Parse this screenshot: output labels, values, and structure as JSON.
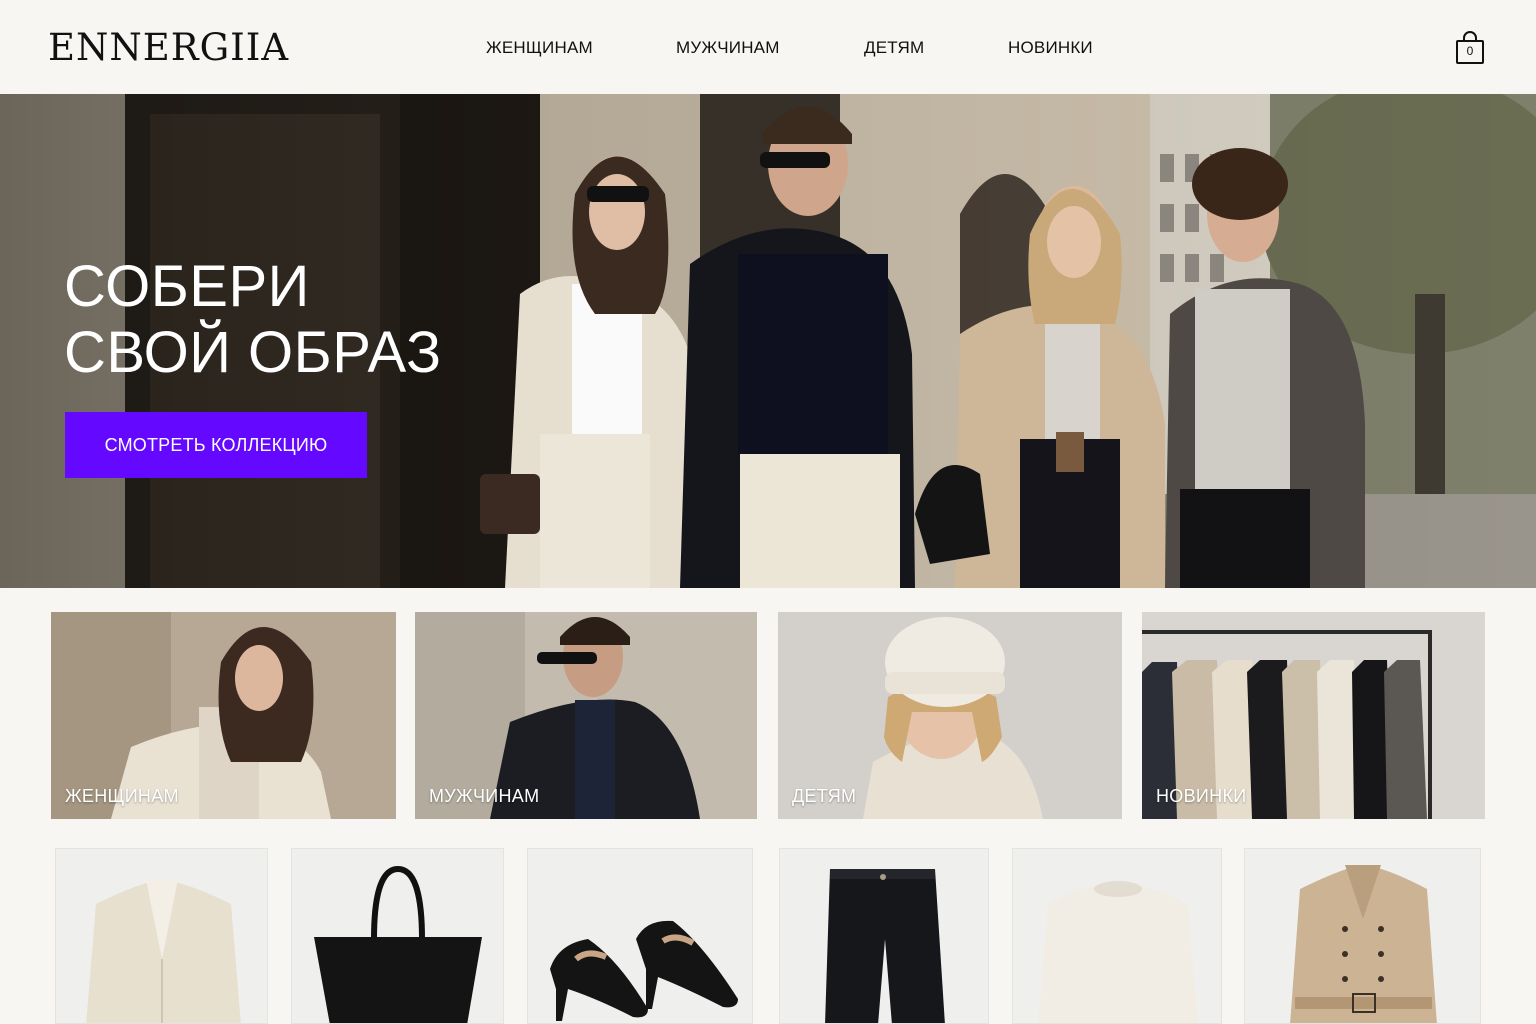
{
  "header": {
    "logo": "ENNERGIIA",
    "nav": [
      "ЖЕНЩИНАМ",
      "МУЖЧИНАМ",
      "ДЕТЯМ",
      "НОВИНКИ"
    ],
    "cart_count": "0",
    "cart_icon": "shopping-bag-icon"
  },
  "hero": {
    "title_line1": "СОБЕРИ",
    "title_line2": "СВОЙ ОБРАЗ",
    "cta": "СМОТРЕТЬ КОЛЛЕКЦИЮ",
    "cta_color": "#6508ff",
    "image": "four models in coats on a city street"
  },
  "categories": [
    {
      "label": "ЖЕНЩИНАМ",
      "image": "woman in cream coat"
    },
    {
      "label": "МУЖЧИНАМ",
      "image": "man in black jacket and sunglasses"
    },
    {
      "label": "ДЕТЯМ",
      "image": "child in beanie and quilted jacket"
    },
    {
      "label": "НОВИНКИ",
      "image": "coats on clothing rack"
    }
  ],
  "products": [
    {
      "image": "cream blazer"
    },
    {
      "image": "black leather tote bag"
    },
    {
      "image": "black slingback heels"
    },
    {
      "image": "black wide jeans"
    },
    {
      "image": "cream knit sweater"
    },
    {
      "image": "beige trench coat"
    }
  ]
}
